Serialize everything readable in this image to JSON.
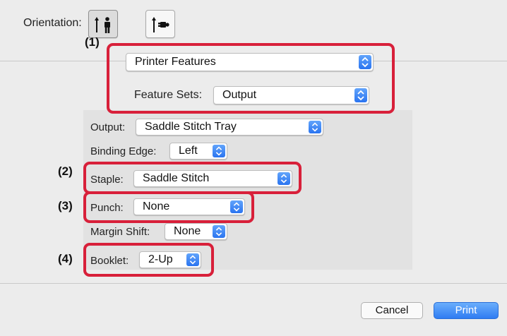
{
  "orientation": {
    "label": "Orientation:",
    "options": [
      "portrait-icon",
      "landscape-icon"
    ],
    "selected": "portrait-icon"
  },
  "printer_features": {
    "menu_value": "Printer Features",
    "feature_sets_label": "Feature Sets:",
    "feature_sets_value": "Output"
  },
  "output": {
    "label": "Output:",
    "value": "Saddle Stitch Tray"
  },
  "binding_edge": {
    "label": "Binding Edge:",
    "value": "Left"
  },
  "staple": {
    "label": "Staple:",
    "value": "Saddle Stitch"
  },
  "punch": {
    "label": "Punch:",
    "value": "None"
  },
  "margin_shift": {
    "label": "Margin Shift:",
    "value": "None"
  },
  "booklet": {
    "label": "Booklet:",
    "value": "2-Up"
  },
  "callouts": [
    "(1)",
    "(2)",
    "(3)",
    "(4)"
  ],
  "buttons": {
    "cancel": "Cancel",
    "print": "Print"
  },
  "colors": {
    "callout": "#d8203a",
    "accent": "#2a74f0",
    "panel": "#e2e2e2",
    "window": "#ececec"
  }
}
